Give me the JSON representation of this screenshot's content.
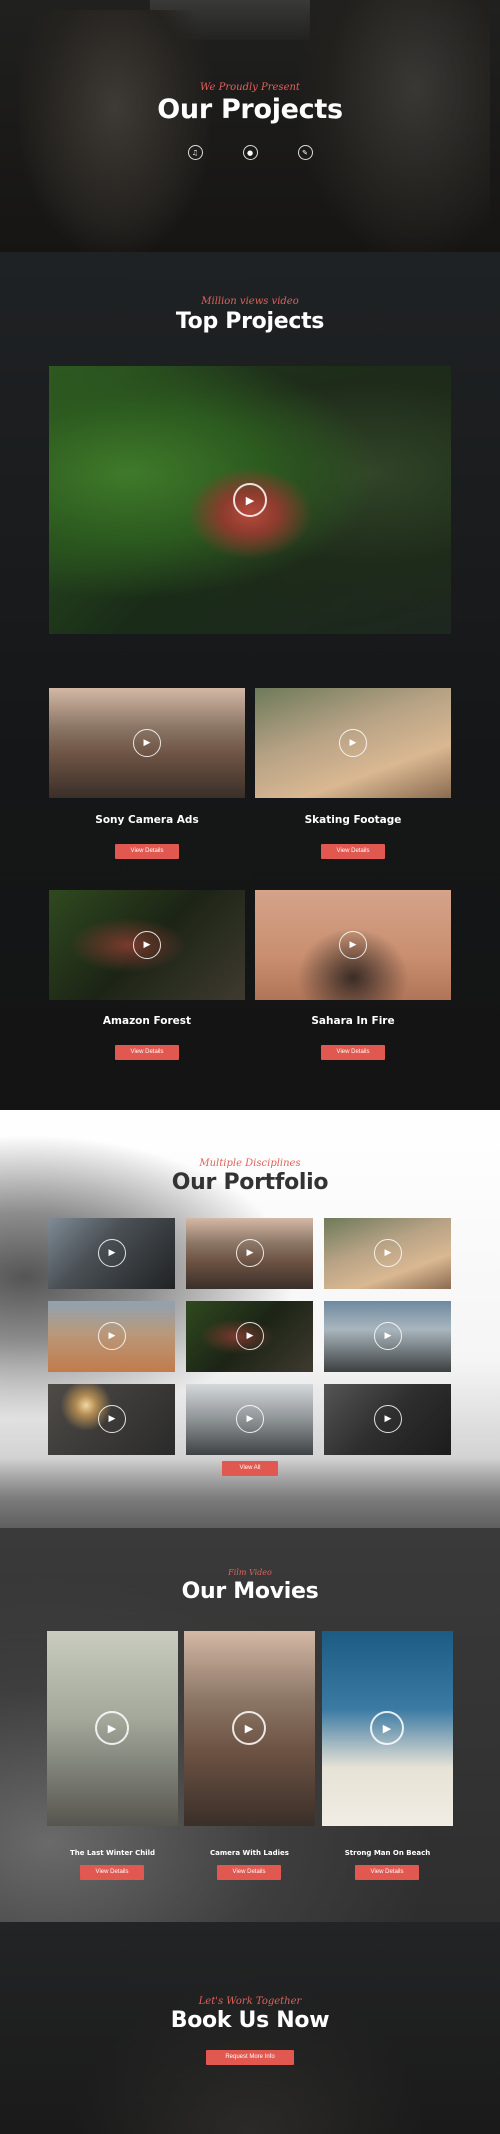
{
  "hero": {
    "eyebrow": "We Proudly Present",
    "title": "Our Projects",
    "icons": [
      "volume-icon",
      "video-camera-icon",
      "pencil-icon"
    ]
  },
  "top_projects": {
    "eyebrow": "Million views video",
    "title": "Top Projects",
    "cards": [
      {
        "title": "Sony Camera Ads",
        "button": "View Details"
      },
      {
        "title": "Skating Footage",
        "button": "View Details"
      },
      {
        "title": "Amazon Forest",
        "button": "View Details"
      },
      {
        "title": "Sahara In Fire",
        "button": "View Details"
      }
    ]
  },
  "portfolio": {
    "eyebrow": "Multiple Disciplines",
    "title": "Our Portfolio",
    "button": "View All"
  },
  "movies": {
    "eyebrow": "Film Video",
    "title": "Our Movies",
    "items": [
      {
        "title": "The Last Winter Child",
        "button": "View Details"
      },
      {
        "title": "Camera With Ladies",
        "button": "View Details"
      },
      {
        "title": "Strong Man On Beach",
        "button": "View Details"
      }
    ]
  },
  "book": {
    "eyebrow": "Let's Work Together",
    "title": "Book Us Now",
    "button": "Request More Info"
  },
  "colors": {
    "accent": "#e0584f",
    "dark_bg": "#151515",
    "light_bg": "#ffffff"
  }
}
